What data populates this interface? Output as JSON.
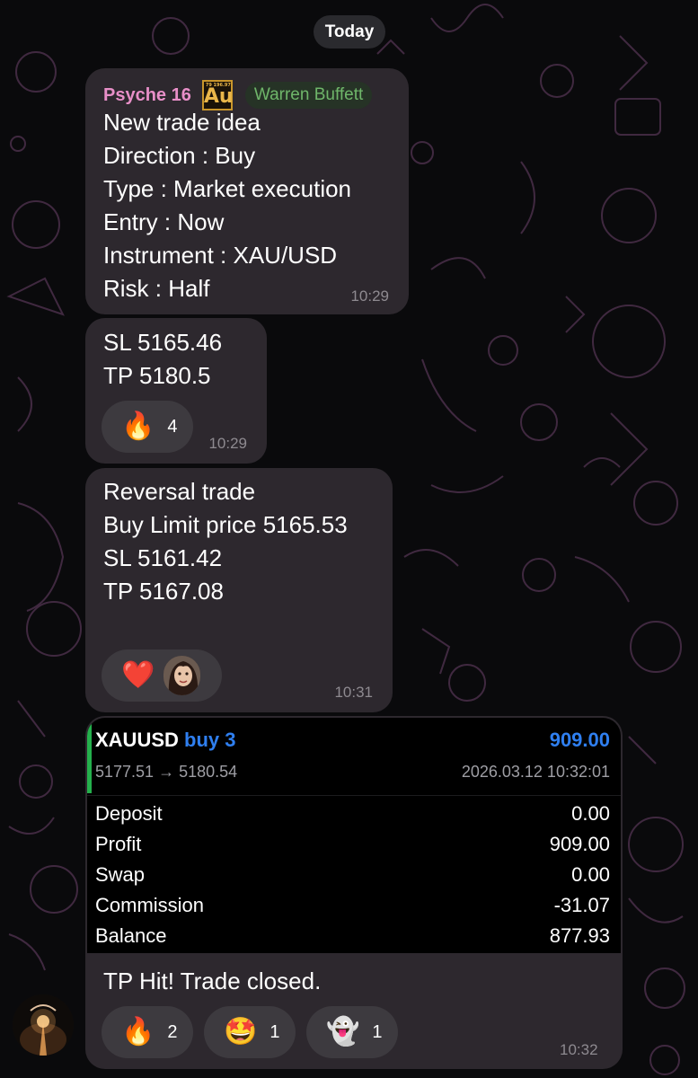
{
  "date_label": "Today",
  "messages": [
    {
      "sender": "Psyche 16",
      "badge_text": "Au",
      "badge_small": "79 196.97 Aurum",
      "tag": "Warren Buffett",
      "lines": [
        "New trade idea",
        "Direction : Buy",
        "Type : Market execution",
        "Entry : Now",
        "Instrument : XAU/USD",
        "Risk : Half"
      ],
      "time": "10:29"
    },
    {
      "lines": [
        "SL 5165.46",
        "TP 5180.5"
      ],
      "reactions": [
        {
          "emoji": "🔥",
          "count": "4"
        }
      ],
      "time": "10:29"
    },
    {
      "lines": [
        "Reversal trade",
        "",
        "Buy Limit price 5165.53",
        "SL 5161.42",
        "TP 5167.08"
      ],
      "reactions": [
        {
          "emoji": "❤️"
        }
      ],
      "time": "10:31"
    },
    {
      "report": {
        "symbol": "XAUUSD",
        "side": "buy 3",
        "amount": "909.00",
        "prices": "5177.51 → 5180.54",
        "datetime": "2026.03.12 10:32:01",
        "rows": [
          {
            "label": "Deposit",
            "value": "0.00"
          },
          {
            "label": "Profit",
            "value": "909.00"
          },
          {
            "label": "Swap",
            "value": "0.00"
          },
          {
            "label": "Commission",
            "value": "-31.07"
          },
          {
            "label": "Balance",
            "value": "877.93"
          }
        ]
      },
      "caption": "TP Hit! Trade closed.",
      "reactions": [
        {
          "emoji": "🔥",
          "count": "2"
        },
        {
          "emoji": "🤩",
          "count": "1"
        },
        {
          "emoji": "👻",
          "count": "1"
        }
      ],
      "time": "10:32"
    }
  ]
}
